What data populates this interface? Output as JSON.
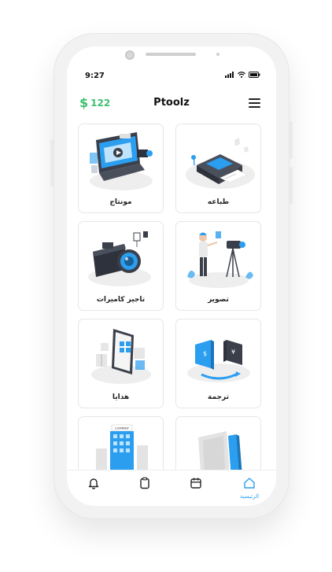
{
  "status_bar": {
    "time": "9:27"
  },
  "header": {
    "balance_symbol": "$",
    "balance": "122",
    "app_name": "Ptoolz"
  },
  "services": [
    {
      "label": "طباعه",
      "icon": "printer-illustration"
    },
    {
      "label": "مونتاج",
      "icon": "video-editing-illustration"
    },
    {
      "label": "تصوير",
      "icon": "photographer-illustration"
    },
    {
      "label": "تاجير كاميرات",
      "icon": "camera-rental-illustration"
    },
    {
      "label": "ترجمة",
      "icon": "translation-illustration"
    },
    {
      "label": "هدايا",
      "icon": "gifts-illustration"
    },
    {
      "label": "",
      "icon": "documents-illustration"
    },
    {
      "label": "",
      "icon": "company-building-illustration"
    }
  ],
  "company_sign": "COMPANY",
  "tabbar": {
    "active_color": "#2b9ef0",
    "home_label": "الرئيسية"
  },
  "colors": {
    "accent_green": "#3fbf6f",
    "accent_blue": "#2b9ef0"
  }
}
